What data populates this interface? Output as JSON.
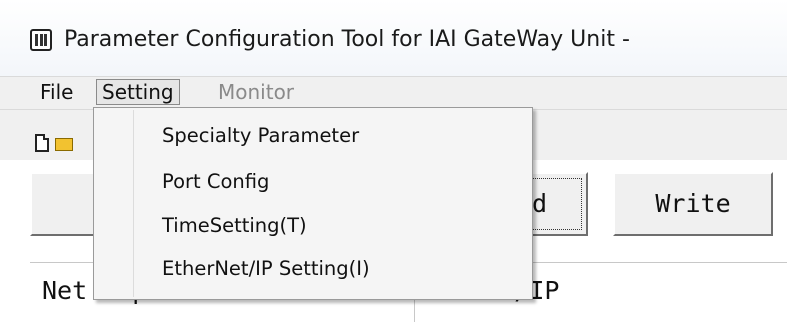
{
  "window": {
    "title": "Parameter Configuration Tool for IAI GateWay Unit -",
    "icon": "app-grid-icon"
  },
  "menubar": {
    "file": "File",
    "setting": "Setting",
    "monitor": "Monitor"
  },
  "toolbar": {
    "icons": [
      "new-file-icon",
      "open-folder-icon"
    ]
  },
  "buttons": {
    "read_visible": "d",
    "write": "Write"
  },
  "grid": {
    "label_partial": "Net   pe",
    "value_partial": "    et/IP"
  },
  "setting_menu": {
    "items": [
      {
        "label": "Specialty Parameter"
      },
      {
        "label": "Port Config"
      },
      {
        "label": "TimeSetting(T)"
      },
      {
        "label": "EtherNet/IP Setting(I)"
      }
    ]
  },
  "colors": {
    "menu_bg": "#f0f0f0",
    "dropdown_bg": "#f5f5f5",
    "disabled_text": "#8a8a8a"
  }
}
